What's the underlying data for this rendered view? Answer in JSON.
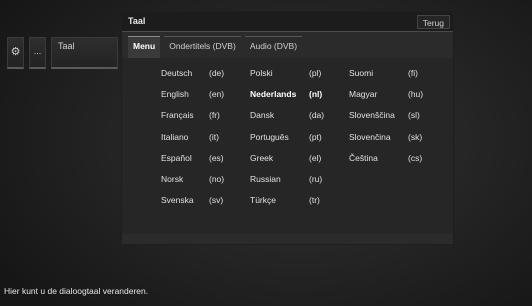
{
  "breadcrumb": {
    "gear_icon": "gear-icon",
    "dots": "...",
    "current": "Taal"
  },
  "dialog": {
    "title": "Taal",
    "back_label": "Terug",
    "tabs": [
      "Menu",
      "Ondertitels (DVB)",
      "Audio (DVB)"
    ],
    "active_tab": "Menu",
    "selected_language": "Nederlands",
    "languages": [
      {
        "name": "Deutsch",
        "code": "(de)"
      },
      {
        "name": "English",
        "code": "(en)"
      },
      {
        "name": "Français",
        "code": "(fr)"
      },
      {
        "name": "Italiano",
        "code": "(it)"
      },
      {
        "name": "Español",
        "code": "(es)"
      },
      {
        "name": "Norsk",
        "code": "(no)"
      },
      {
        "name": "Svenska",
        "code": "(sv)"
      },
      {
        "name": "Polski",
        "code": "(pl)"
      },
      {
        "name": "Nederlands",
        "code": "(nl)"
      },
      {
        "name": "Dansk",
        "code": "(da)"
      },
      {
        "name": "Português",
        "code": "(pt)"
      },
      {
        "name": "Greek",
        "code": "(el)"
      },
      {
        "name": "Russian",
        "code": "(ru)"
      },
      {
        "name": "Türkçe",
        "code": "(tr)"
      },
      {
        "name": "Suomi",
        "code": "(fi)"
      },
      {
        "name": "Magyar",
        "code": "(hu)"
      },
      {
        "name": "Slovenščina",
        "code": "(sl)"
      },
      {
        "name": "Slovenčina",
        "code": "(sk)"
      },
      {
        "name": "Čeština",
        "code": "(cs)"
      }
    ]
  },
  "status_text": "Hier kunt u de dialoogtaal veranderen."
}
